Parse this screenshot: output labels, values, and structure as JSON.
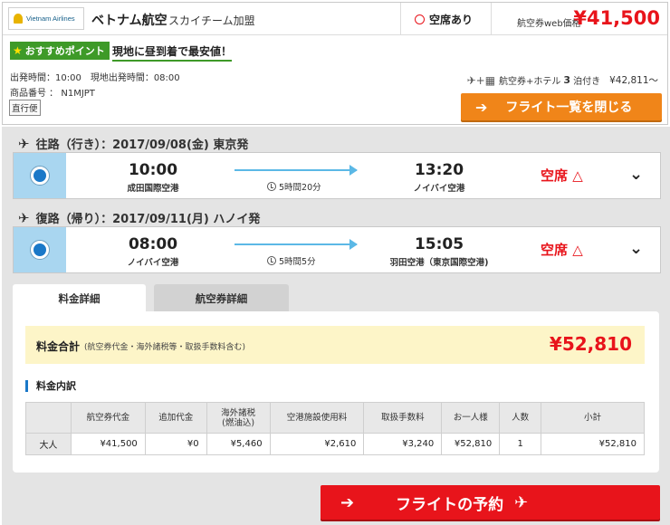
{
  "header": {
    "logo_text": "Vietnam Airlines",
    "airline_name": "ベトナム航空",
    "alliance": "スカイチーム加盟",
    "seat_availability": "空席あり",
    "price_label": "航空券web価格",
    "price_value": "¥41,500",
    "recommend_badge": "おすすめポイント",
    "recommend_text": "現地に昼到着で最安値！",
    "departure_time_text": "出発時間：10:00　現地出発時間：08:00",
    "product_code_text": "商品番号 ： N1MJPT",
    "direct_tag": "直行便",
    "package_label": "航空券+ホテル",
    "package_nights": "3",
    "package_nights_suffix": "泊付き",
    "package_price": "¥42,811〜",
    "close_button": "フライト一覧を閉じる"
  },
  "outbound": {
    "title": "往路（行き）：2017/09/08(金) 東京発",
    "dep_time": "10:00",
    "dep_airport": "成田国際空港",
    "duration": "5時間20分",
    "arr_time": "13:20",
    "arr_airport": "ノイバイ空港",
    "seat_status": "空席 △"
  },
  "inbound": {
    "title": "復路（帰り）：2017/09/11(月) ハノイ発",
    "dep_time": "08:00",
    "dep_airport": "ノイバイ空港",
    "duration": "5時間5分",
    "arr_time": "15:05",
    "arr_airport": "羽田空港（東京国際空港)",
    "seat_status": "空席 △"
  },
  "tabs": [
    {
      "label": "料金詳細",
      "active": true
    },
    {
      "label": "航空券詳細",
      "active": false
    }
  ],
  "fare": {
    "total_label": "料金合計",
    "total_note": "(航空券代金・海外諸税等・取扱手数料含む)",
    "total_value": "¥52,810",
    "breakdown_title": "料金内訳",
    "columns": [
      "",
      "航空券代金",
      "追加代金",
      "海外諸税\n(燃油込)",
      "空港施設使用料",
      "取扱手数料",
      "お一人様",
      "人数",
      "小計"
    ],
    "rows": [
      [
        "大人",
        "¥41,500",
        "¥0",
        "¥5,460",
        "¥2,610",
        "¥3,240",
        "¥52,810",
        "1",
        "¥52,810"
      ]
    ]
  },
  "book_button": "フライトの予約",
  "colors": {
    "price_red": "#e8141b",
    "accent_orange": "#f08519",
    "radio_blue": "#1a78c8",
    "badge_green": "#3e9a28"
  }
}
